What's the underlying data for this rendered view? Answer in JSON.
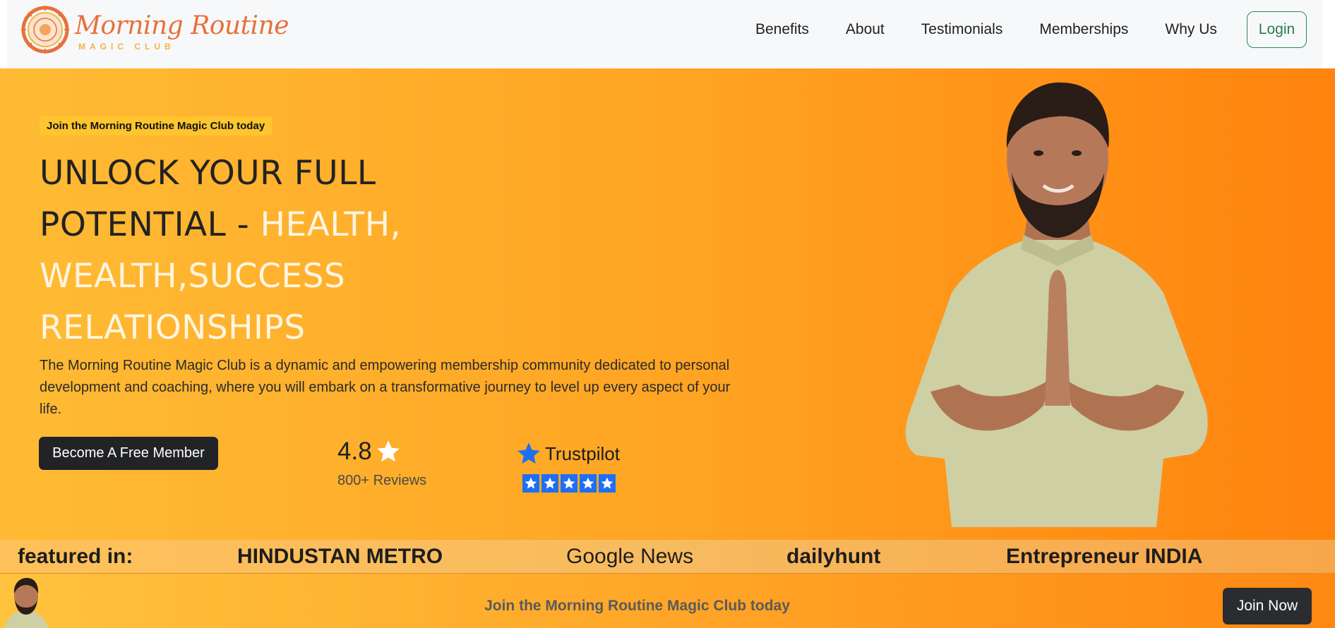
{
  "brand": {
    "title": "Morning Routine",
    "subtitle": "MAGIC CLUB",
    "accent": "#e8703a",
    "accent2": "#f2b441"
  },
  "nav": {
    "items": [
      {
        "label": "Benefits"
      },
      {
        "label": "About"
      },
      {
        "label": "Testimonials"
      },
      {
        "label": "Memberships"
      },
      {
        "label": "Why Us"
      }
    ],
    "login_label": "Login"
  },
  "hero": {
    "badge": "Join the Morning Routine Magic Club today",
    "title_dark": "UNLOCK YOUR FULL POTENTIAL - ",
    "title_highlight": "HEALTH, WEALTH,SUCCESS RELATIONSHIPS",
    "description": "The Morning Routine Magic Club is a dynamic and empowering membership community dedicated to personal development and coaching, where you will embark on a transformative journey to level up every aspect of your life.",
    "cta_label": "Become A Free Member",
    "rating_value": "4.8",
    "rating_reviews": "800+ Reviews",
    "trustpilot_label": "Trustpilot",
    "trustpilot_stars": 5,
    "gradient_start": "#ffbb35",
    "gradient_end": "#ff830e"
  },
  "featured": {
    "label": "featured in:",
    "outlets": [
      "HINDUSTAN METRO",
      "Google News",
      "dailyhunt",
      "Entrepreneur INDIA"
    ]
  },
  "sticky_bar": {
    "text": "Join the Morning Routine Magic Club today",
    "button_label": "Join Now"
  },
  "icons": {
    "rating": "star-icon",
    "trustpilot": "trustpilot-star-icon",
    "logo": "sun-mandala-icon"
  }
}
